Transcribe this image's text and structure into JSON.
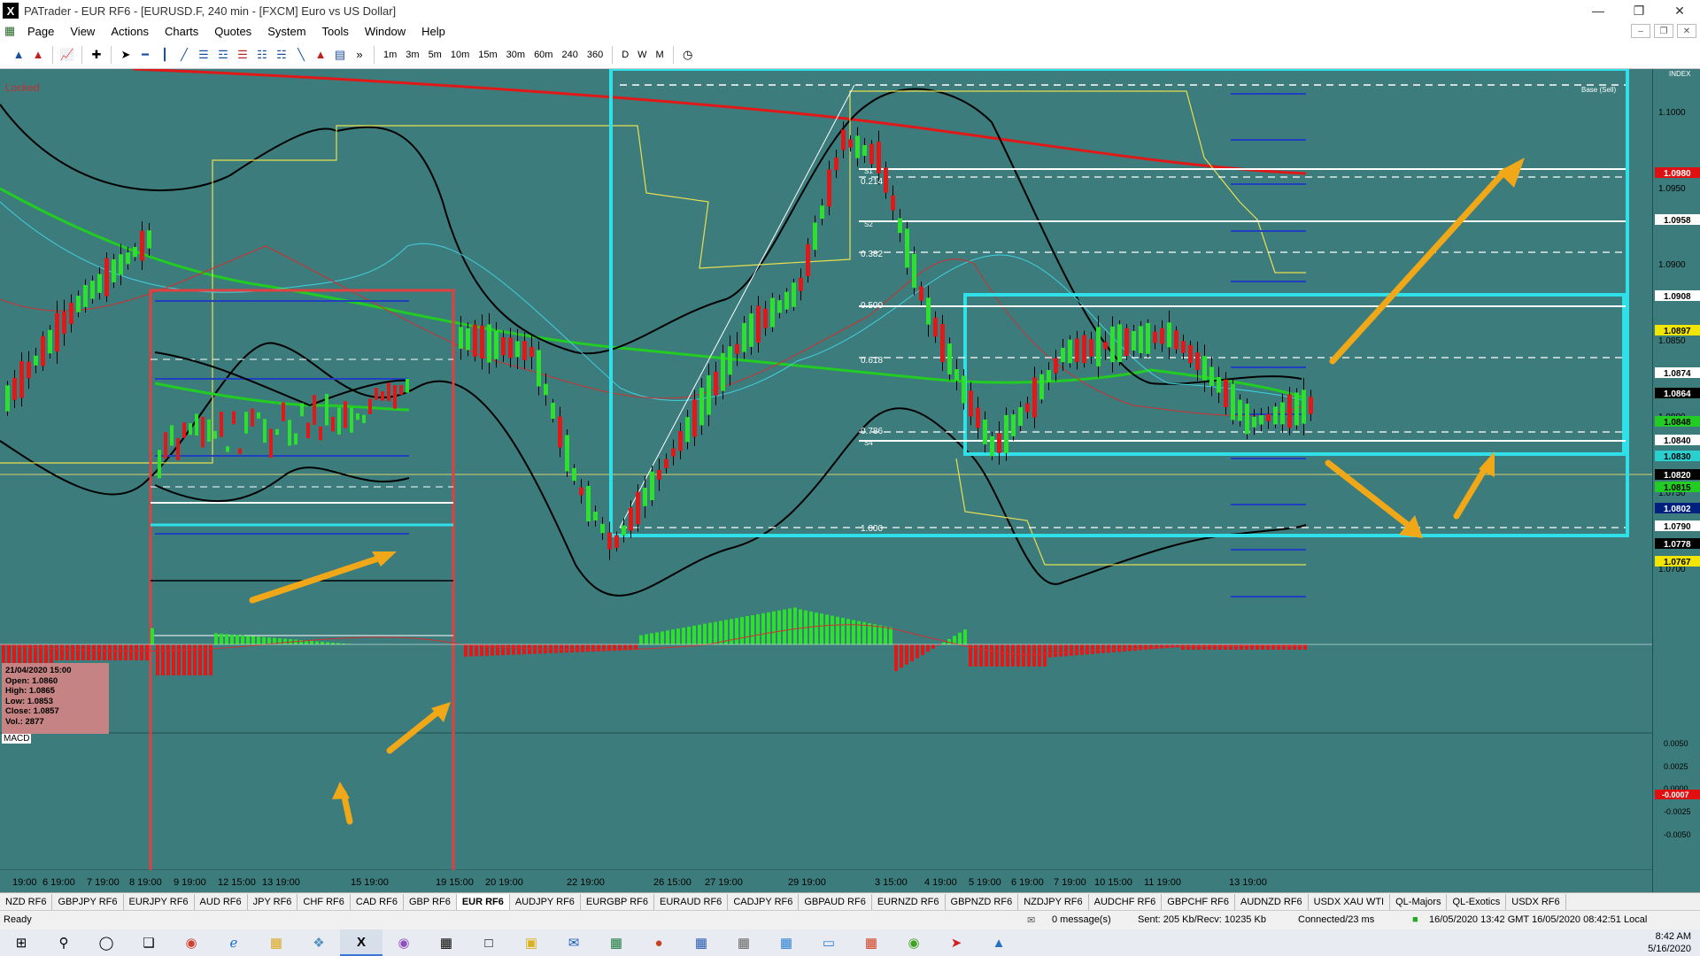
{
  "window": {
    "title": "PATrader - EUR RF6 - [EURUSD.F, 240 min - [FXCM] Euro vs US Dollar]",
    "app_icon": "X"
  },
  "menu": [
    "Page",
    "View",
    "Actions",
    "Charts",
    "Quotes",
    "System",
    "Tools",
    "Window",
    "Help"
  ],
  "timeframes": [
    "1m",
    "3m",
    "5m",
    "10m",
    "15m",
    "30m",
    "60m",
    "240",
    "360",
    "D",
    "W",
    "M"
  ],
  "chart": {
    "locked_label": "Locked",
    "index_label": "INDEX",
    "macd_label": "MACD",
    "info": {
      "date": "21/04/2020 15:00",
      "open": "Open: 1.0860",
      "high": "High: 1.0865",
      "low": "Low: 1.0853",
      "close": "Close: 1.0857",
      "vol": "Vol.: 2877"
    },
    "price_ticks": [
      "1.1000",
      "1.0950",
      "1.0900",
      "1.0850",
      "1.0800",
      "1.0750",
      "1.0700"
    ],
    "macd_ticks": [
      "0.0050",
      "0.0025",
      "0.0000",
      "-0.0025",
      "-0.0050"
    ],
    "price_tags": [
      {
        "value": "1.0980",
        "color": "#e01010"
      },
      {
        "value": "1.0958",
        "color": "#ffffff"
      },
      {
        "value": "1.0908",
        "color": "#ffffff"
      },
      {
        "value": "1.0897",
        "color": "#f2e600"
      },
      {
        "value": "1.0874",
        "color": "#ffffff"
      },
      {
        "value": "1.0864",
        "color": "#000000"
      },
      {
        "value": "1.0848",
        "color": "#22cc22"
      },
      {
        "value": "1.0840",
        "color": "#ffffff"
      },
      {
        "value": "1.0830",
        "color": "#2ad0d0"
      },
      {
        "value": "1.0820",
        "color": "#000000"
      },
      {
        "value": "1.0815",
        "color": "#22cc22"
      },
      {
        "value": "1.0802",
        "color": "#002080"
      },
      {
        "value": "1.0790",
        "color": "#ffffff"
      },
      {
        "value": "1.0778",
        "color": "#000000"
      },
      {
        "value": "1.0767",
        "color": "#f2e600"
      }
    ],
    "macd_tag": {
      "value": "-0.0007",
      "color": "#e01010"
    },
    "fib_labels": [
      "0.214",
      "0.382",
      "0.500",
      "0.618",
      "0.786",
      "1.000"
    ],
    "pivot_labels": [
      "S1",
      "S2",
      "S4",
      "Base (Sell)"
    ],
    "x_labels": [
      "19:00",
      "6 19:00",
      "7 19:00",
      "8 19:00",
      "9 19:00",
      "12 15:00",
      "13 19:00",
      "15 19:00",
      "19 15:00",
      "20 19:00",
      "22 19:00",
      "26 15:00",
      "27 19:00",
      "29 19:00",
      "3 15:00",
      "4 19:00",
      "5 19:00",
      "6 19:00",
      "7 19:00",
      "10 15:00",
      "11 19:00",
      "13 19:00"
    ]
  },
  "tabs": [
    "NZD RF6",
    "GBPJPY RF6",
    "EURJPY RF6",
    "AUD RF6",
    "JPY RF6",
    "CHF RF6",
    "CAD RF6",
    "GBP RF6",
    "EUR RF6",
    "AUDJPY RF6",
    "EURGBP RF6",
    "EURAUD RF6",
    "CADJPY RF6",
    "GBPAUD RF6",
    "EURNZD RF6",
    "GBPNZD RF6",
    "NZDJPY RF6",
    "AUDCHF RF6",
    "GBPCHF RF6",
    "AUDNZD RF6",
    "USDX XAU WTI",
    "QL-Majors",
    "QL-Exotics",
    "USDX RF6"
  ],
  "active_tab": "EUR RF6",
  "status": {
    "ready": "Ready",
    "messages": "0 message(s)",
    "traffic": "Sent: 205 Kb/Recv: 10235 Kb",
    "connection": "Connected/23 ms",
    "times": "16/05/2020 13:42 GMT  16/05/2020 08:42:51 Local"
  },
  "taskbar": {
    "time": "8:42 AM",
    "date": "5/16/2020"
  }
}
